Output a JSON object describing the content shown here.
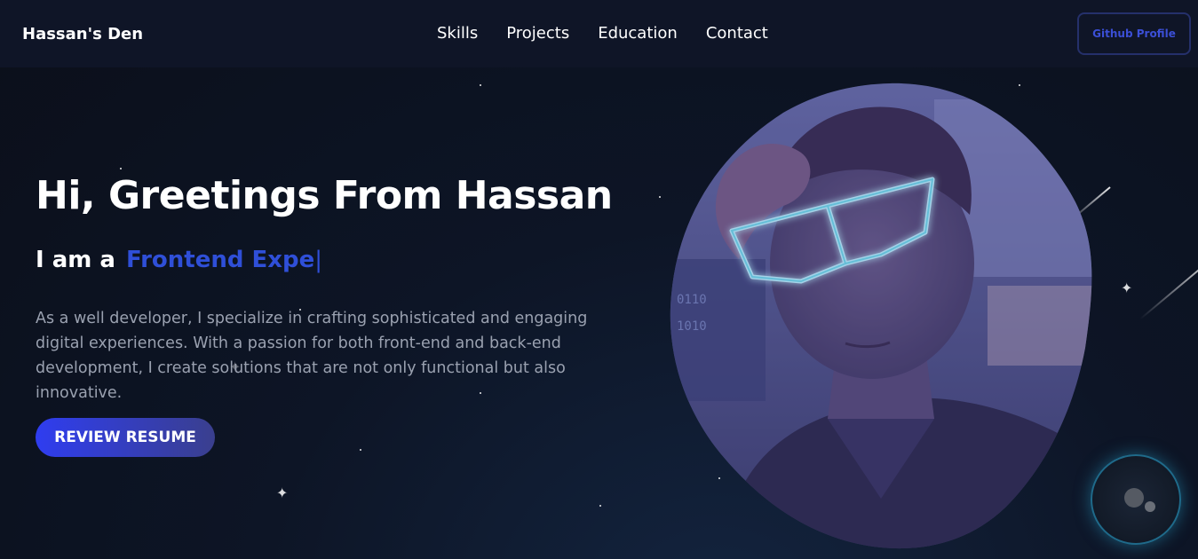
{
  "header": {
    "brand": "Hassan's Den",
    "nav": [
      "Skills",
      "Projects",
      "Education",
      "Contact"
    ],
    "github_label": "Github Profile"
  },
  "hero": {
    "title": "Hi, Greetings From Hassan",
    "subtitle_prefix": "I am a",
    "typed_text": "Frontend Expe",
    "cursor": "|",
    "description": "As a well developer, I specialize in crafting sophisticated and engaging digital experiences. With a passion for both front-end and back-end development, I create solutions that are not only functional but also innovative.",
    "resume_label": "REVIEW RESUME"
  },
  "colors": {
    "accent": "#2f4fd8",
    "button_gradient_start": "#2f3df0",
    "button_gradient_end": "#3a3f8e",
    "background": "#0d1526"
  },
  "icons": {
    "chat": "chat-bubble-icon",
    "photo": "profile-photo"
  }
}
